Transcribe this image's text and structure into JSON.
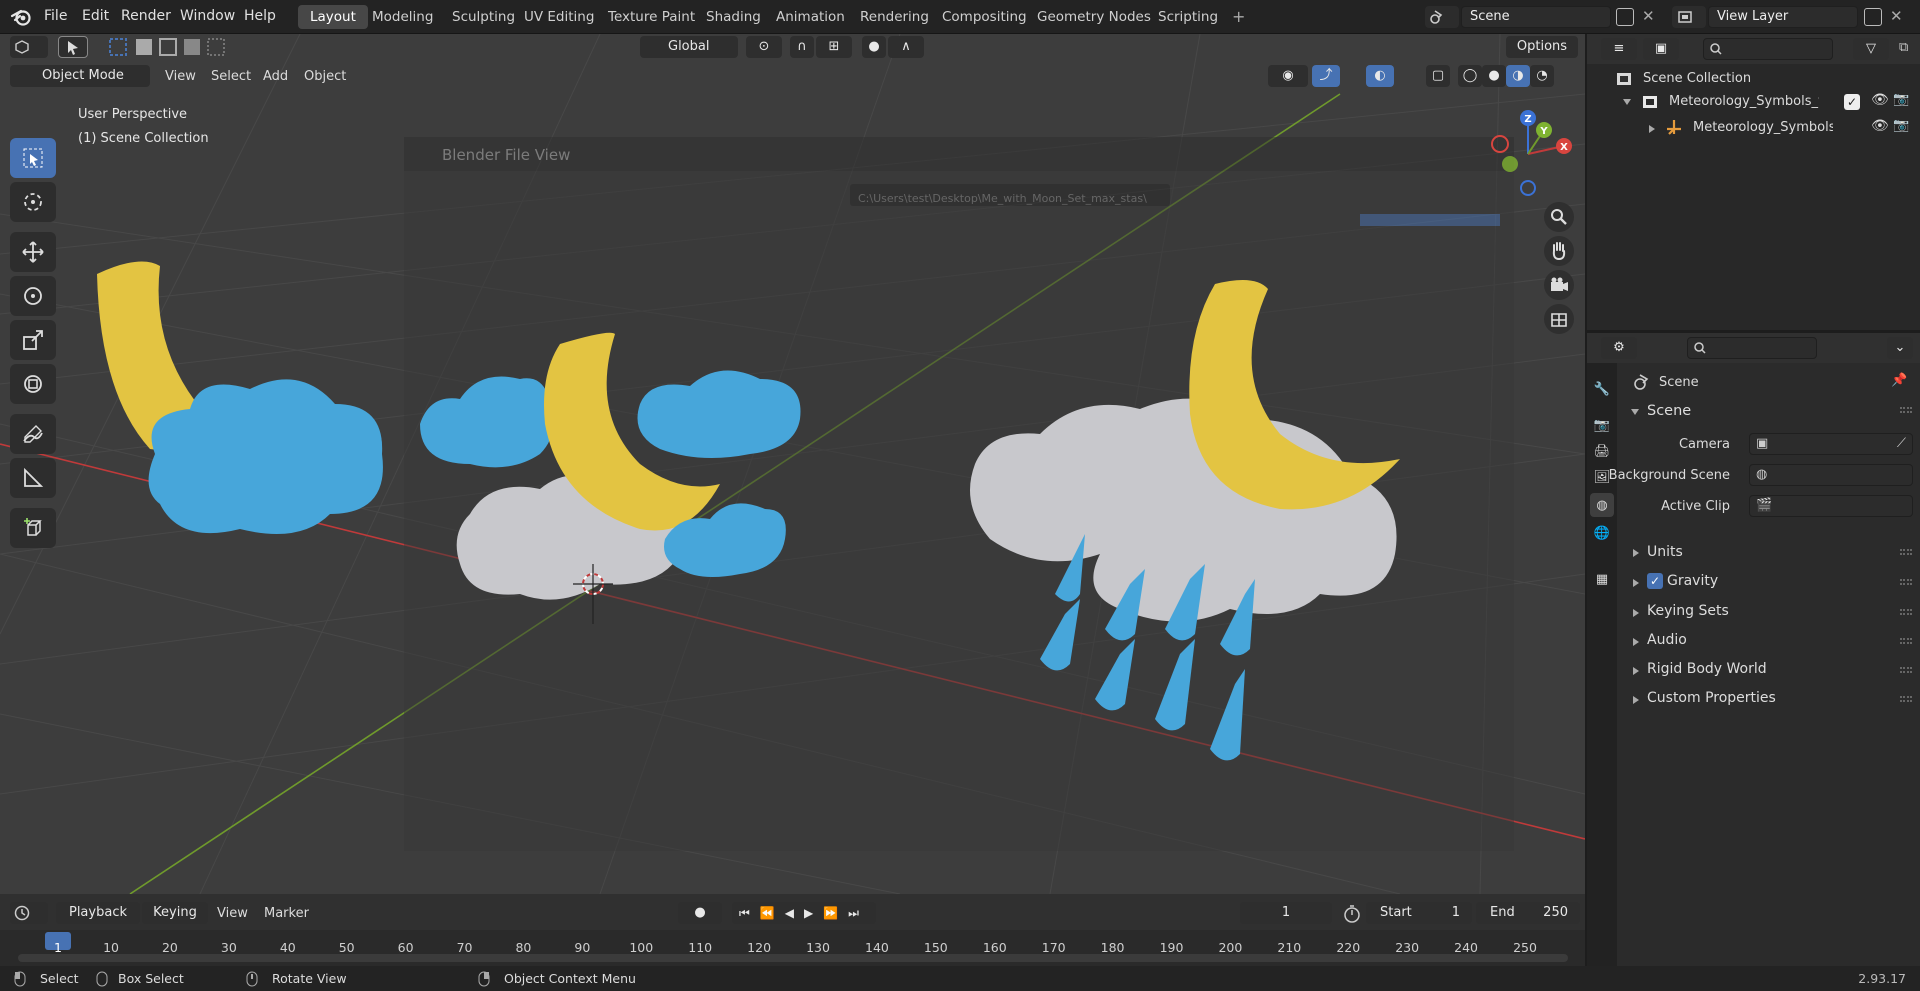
{
  "topbar": {
    "menus": [
      "File",
      "Edit",
      "Render",
      "Window",
      "Help"
    ],
    "workspaces": [
      "Layout",
      "Modeling",
      "Sculpting",
      "UV Editing",
      "Texture Paint",
      "Shading",
      "Animation",
      "Rendering",
      "Compositing",
      "Geometry Nodes",
      "Scripting"
    ],
    "active_workspace": "Layout",
    "add_tab": "+",
    "scene_name": "Scene",
    "view_layer": "View Layer"
  },
  "viewport_header": {
    "mode": "Object Mode",
    "menus": [
      "View",
      "Select",
      "Add",
      "Object"
    ],
    "transform_orientation": "Global",
    "options": "Options"
  },
  "viewport": {
    "perspective_label": "User Perspective",
    "collection_label": "(1) Scene Collection",
    "gizmo_axes": {
      "x": "X",
      "y": "Y",
      "z": "Z"
    }
  },
  "file_view_overlay": {
    "title": "Blender File View",
    "path": "C:\\Users\\test\\Desktop\\Me_with_Moon_Set_max_stas\\"
  },
  "outliner": {
    "root": "Scene Collection",
    "items": [
      {
        "label": "Meteorology_Symbols_with_N"
      },
      {
        "label": "Meteorology_Symbols_w"
      }
    ]
  },
  "properties": {
    "context_title": "Scene",
    "section": "Scene",
    "rows": [
      {
        "label": "Camera"
      },
      {
        "label": "Background Scene"
      },
      {
        "label": "Active Clip"
      }
    ],
    "panels": [
      "Units",
      "Gravity",
      "Keying Sets",
      "Audio",
      "Rigid Body World",
      "Custom Properties"
    ],
    "gravity_checked": true
  },
  "timeline": {
    "menus": [
      "Playback",
      "Keying",
      "View",
      "Marker"
    ],
    "current_frame": 1,
    "start_label": "Start",
    "start": 1,
    "end_label": "End",
    "end": 250,
    "ticks": [
      1,
      10,
      20,
      30,
      40,
      50,
      60,
      70,
      80,
      90,
      100,
      110,
      120,
      130,
      140,
      150,
      160,
      170,
      180,
      190,
      200,
      210,
      220,
      230,
      240,
      250
    ]
  },
  "statusbar": {
    "select": "Select",
    "box_select": "Box Select",
    "rotate_view": "Rotate View",
    "context_menu": "Object Context Menu",
    "version": "2.93.17"
  },
  "colors": {
    "accent": "#4772b3",
    "moon": "#e3c442",
    "cloud_blue": "#47a6da",
    "cloud_grey": "#c8c8cc",
    "axis_x": "#c03a3a",
    "axis_y": "#6f9a2c"
  }
}
